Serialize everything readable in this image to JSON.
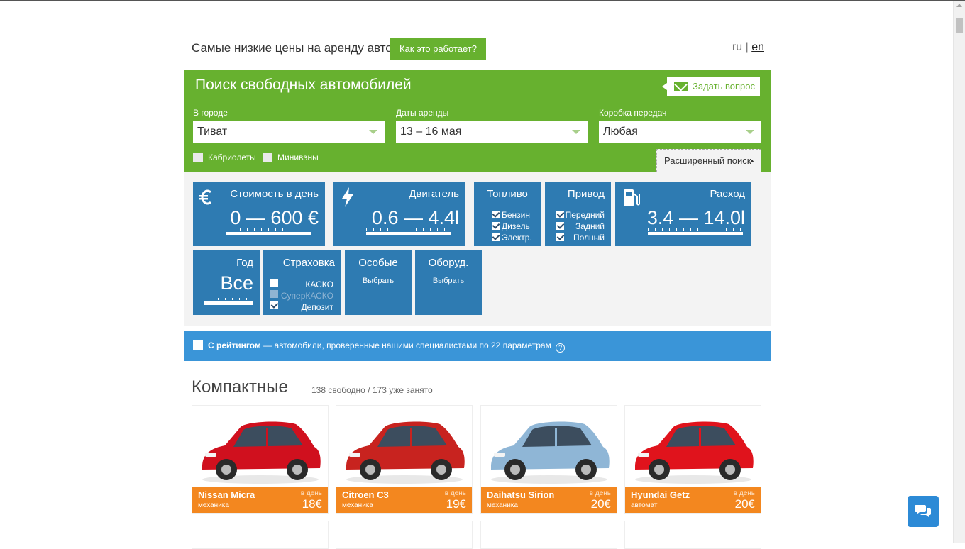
{
  "header": {
    "tagline": "Самые низкие цены на аренду авто",
    "how_button": "Как это работает?",
    "lang_ru": "ru",
    "lang_sep": "|",
    "lang_en": "en"
  },
  "search": {
    "title": "Поиск свободных автомобилей",
    "ask_button": "Задать вопрос",
    "city_label": "В городе",
    "city_value": "Тиват",
    "dates_label": "Даты аренды",
    "dates_value": "13 – 16 мая",
    "gearbox_label": "Коробка передач",
    "gearbox_value": "Любая",
    "convertibles": "Кабриолеты",
    "minivans": "Минивэны",
    "advanced_button": "Расширенный поиск"
  },
  "filters": {
    "price": {
      "title": "Стоимость в день",
      "value": "0 — 600 €",
      "icon": "euro-icon"
    },
    "engine": {
      "title": "Двигатель",
      "value": "0.6 — 4.4l",
      "icon": "lightning-icon"
    },
    "fuel": {
      "title": "Топливо",
      "options": [
        "Бензин",
        "Дизель",
        "Электр."
      ],
      "checked": [
        true,
        true,
        true
      ]
    },
    "drive": {
      "title": "Привод",
      "options": [
        "Передний",
        "Задний",
        "Полный"
      ],
      "checked": [
        true,
        true,
        true
      ]
    },
    "consumption": {
      "title": "Расход",
      "value": "3.4 — 14.0l",
      "icon": "fuel-pump-icon"
    },
    "year": {
      "title": "Год",
      "value": "Все"
    },
    "insurance": {
      "title": "Страховка",
      "options": [
        "КАСКО",
        "СуперКАСКО",
        "Депозит"
      ],
      "checked": [
        false,
        false,
        true
      ]
    },
    "special": {
      "title": "Особые",
      "link": "Выбрать"
    },
    "equipment": {
      "title": "Оборуд.",
      "link": "Выбрать"
    }
  },
  "rating": {
    "bold": "С рейтингом",
    "text": " — автомобили, проверенные нашими специалистами по 22 параметрам",
    "help_icon": "?"
  },
  "section": {
    "title": "Компактные",
    "meta": "138 свободно / 173 уже занято"
  },
  "cars": [
    {
      "name": "Nissan Micra",
      "transmission": "механика",
      "per_day": "в день",
      "price": "18€",
      "color": "#d0101e"
    },
    {
      "name": "Citroen C3",
      "transmission": "механика",
      "per_day": "в день",
      "price": "19€",
      "color": "#c8231f"
    },
    {
      "name": "Daihatsu Sirion",
      "transmission": "механика",
      "per_day": "в день",
      "price": "20€",
      "color": "#8fb6d6"
    },
    {
      "name": "Hyundai Getz",
      "transmission": "автомат",
      "per_day": "в день",
      "price": "20€",
      "color": "#e0131c"
    }
  ],
  "colors": {
    "green": "#67b12f",
    "blue_tile": "#2e7bb2",
    "rating_blue": "#3a95d8",
    "orange": "#f3871f"
  }
}
